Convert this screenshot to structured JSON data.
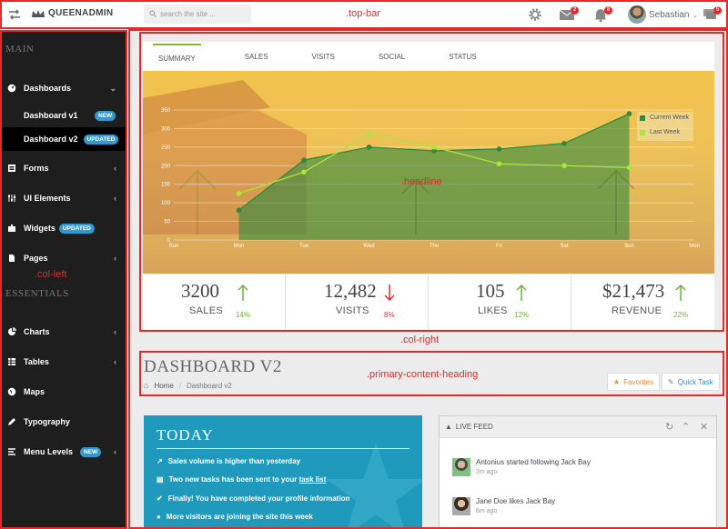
{
  "topbar": {
    "logo": "QUEENADMIN",
    "search_placeholder": "search the site ...",
    "mail_count": "2",
    "bell_count": "8",
    "chat_count": "5",
    "user_name": "Sebastian"
  },
  "sidebar": {
    "main_heading": "MAIN",
    "essentials_heading": "ESSENTIALS",
    "dashboards": "Dashboards",
    "dashboard_v1": "Dashboard v1",
    "dashboard_v1_badge": "NEW",
    "dashboard_v2": "Dashboard v2",
    "dashboard_v2_badge": "UPDATED",
    "forms": "Forms",
    "ui_elements": "UI Elements",
    "widgets": "Widgets",
    "widgets_badge": "UPDATED",
    "pages": "Pages",
    "charts": "Charts",
    "tables": "Tables",
    "maps": "Maps",
    "typography": "Typography",
    "menu_levels": "Menu Levels",
    "menu_levels_badge": "NEW"
  },
  "tabs": [
    "SUMMARY",
    "SALES",
    "VISITS",
    "SOCIAL",
    "STATUS"
  ],
  "stats": [
    {
      "value": "3200",
      "label": "SALES",
      "pct": "14%",
      "dir": "up"
    },
    {
      "value": "12,482",
      "label": "VISITS",
      "pct": "8%",
      "dir": "down"
    },
    {
      "value": "105",
      "label": "LIKES",
      "pct": "12%",
      "dir": "up"
    },
    {
      "value": "$21,473",
      "label": "REVENUE",
      "pct": "22%",
      "dir": "up"
    }
  ],
  "chart_data": {
    "type": "line",
    "categories": [
      "Sun",
      "Mon",
      "Tue",
      "Wed",
      "Thu",
      "Fri",
      "Sat",
      "Sun",
      "Mon"
    ],
    "series": [
      {
        "name": "Current Week",
        "x": [
          1,
          2,
          3,
          4,
          5,
          6,
          7
        ],
        "values": [
          80,
          215,
          250,
          240,
          245,
          260,
          340
        ],
        "color": "#2e8b3e"
      },
      {
        "name": "Last Week",
        "x": [
          1,
          2,
          3,
          4,
          5,
          6,
          7
        ],
        "values": [
          125,
          183,
          285,
          250,
          205,
          200,
          195
        ],
        "color": "#a8e63c"
      }
    ],
    "ylim": [
      0,
      350
    ],
    "yticks": [
      0,
      50,
      100,
      150,
      200,
      250,
      300,
      350
    ],
    "legend": "top-right"
  },
  "heading": {
    "title": "DASHBOARD V2",
    "crumb_home": "Home",
    "crumb_current": "Dashboard v2",
    "favorites": "Favorites",
    "quick_task": "Quick Task"
  },
  "today": {
    "title": "TODAY",
    "item1": "Sales volume is higher than yesterday",
    "item2_a": "Two new tasks has been sent to your ",
    "item2_link": "task list",
    "item3": "Finally! You have completed your profile information",
    "item4": "More visitors are joining the site this week"
  },
  "feed": {
    "title": "LIVE FEED",
    "items": [
      {
        "text": "Antonius started following Jack Bay",
        "time": "2m ago"
      },
      {
        "text": "Jane Doe likes Jack Bay",
        "time": "6m ago"
      }
    ]
  },
  "labels": {
    "top_bar": ".top-bar",
    "col_left": ".col-left",
    "headline": ".headline",
    "col_right": ".col-right",
    "primary_heading": ".primary-content-heading"
  },
  "colors": {
    "accent_red": "#e52929",
    "badge_blue": "#3399cc",
    "today_bg": "#1f9abc",
    "up_green": "#6cb33f",
    "down_red": "#e52929"
  }
}
